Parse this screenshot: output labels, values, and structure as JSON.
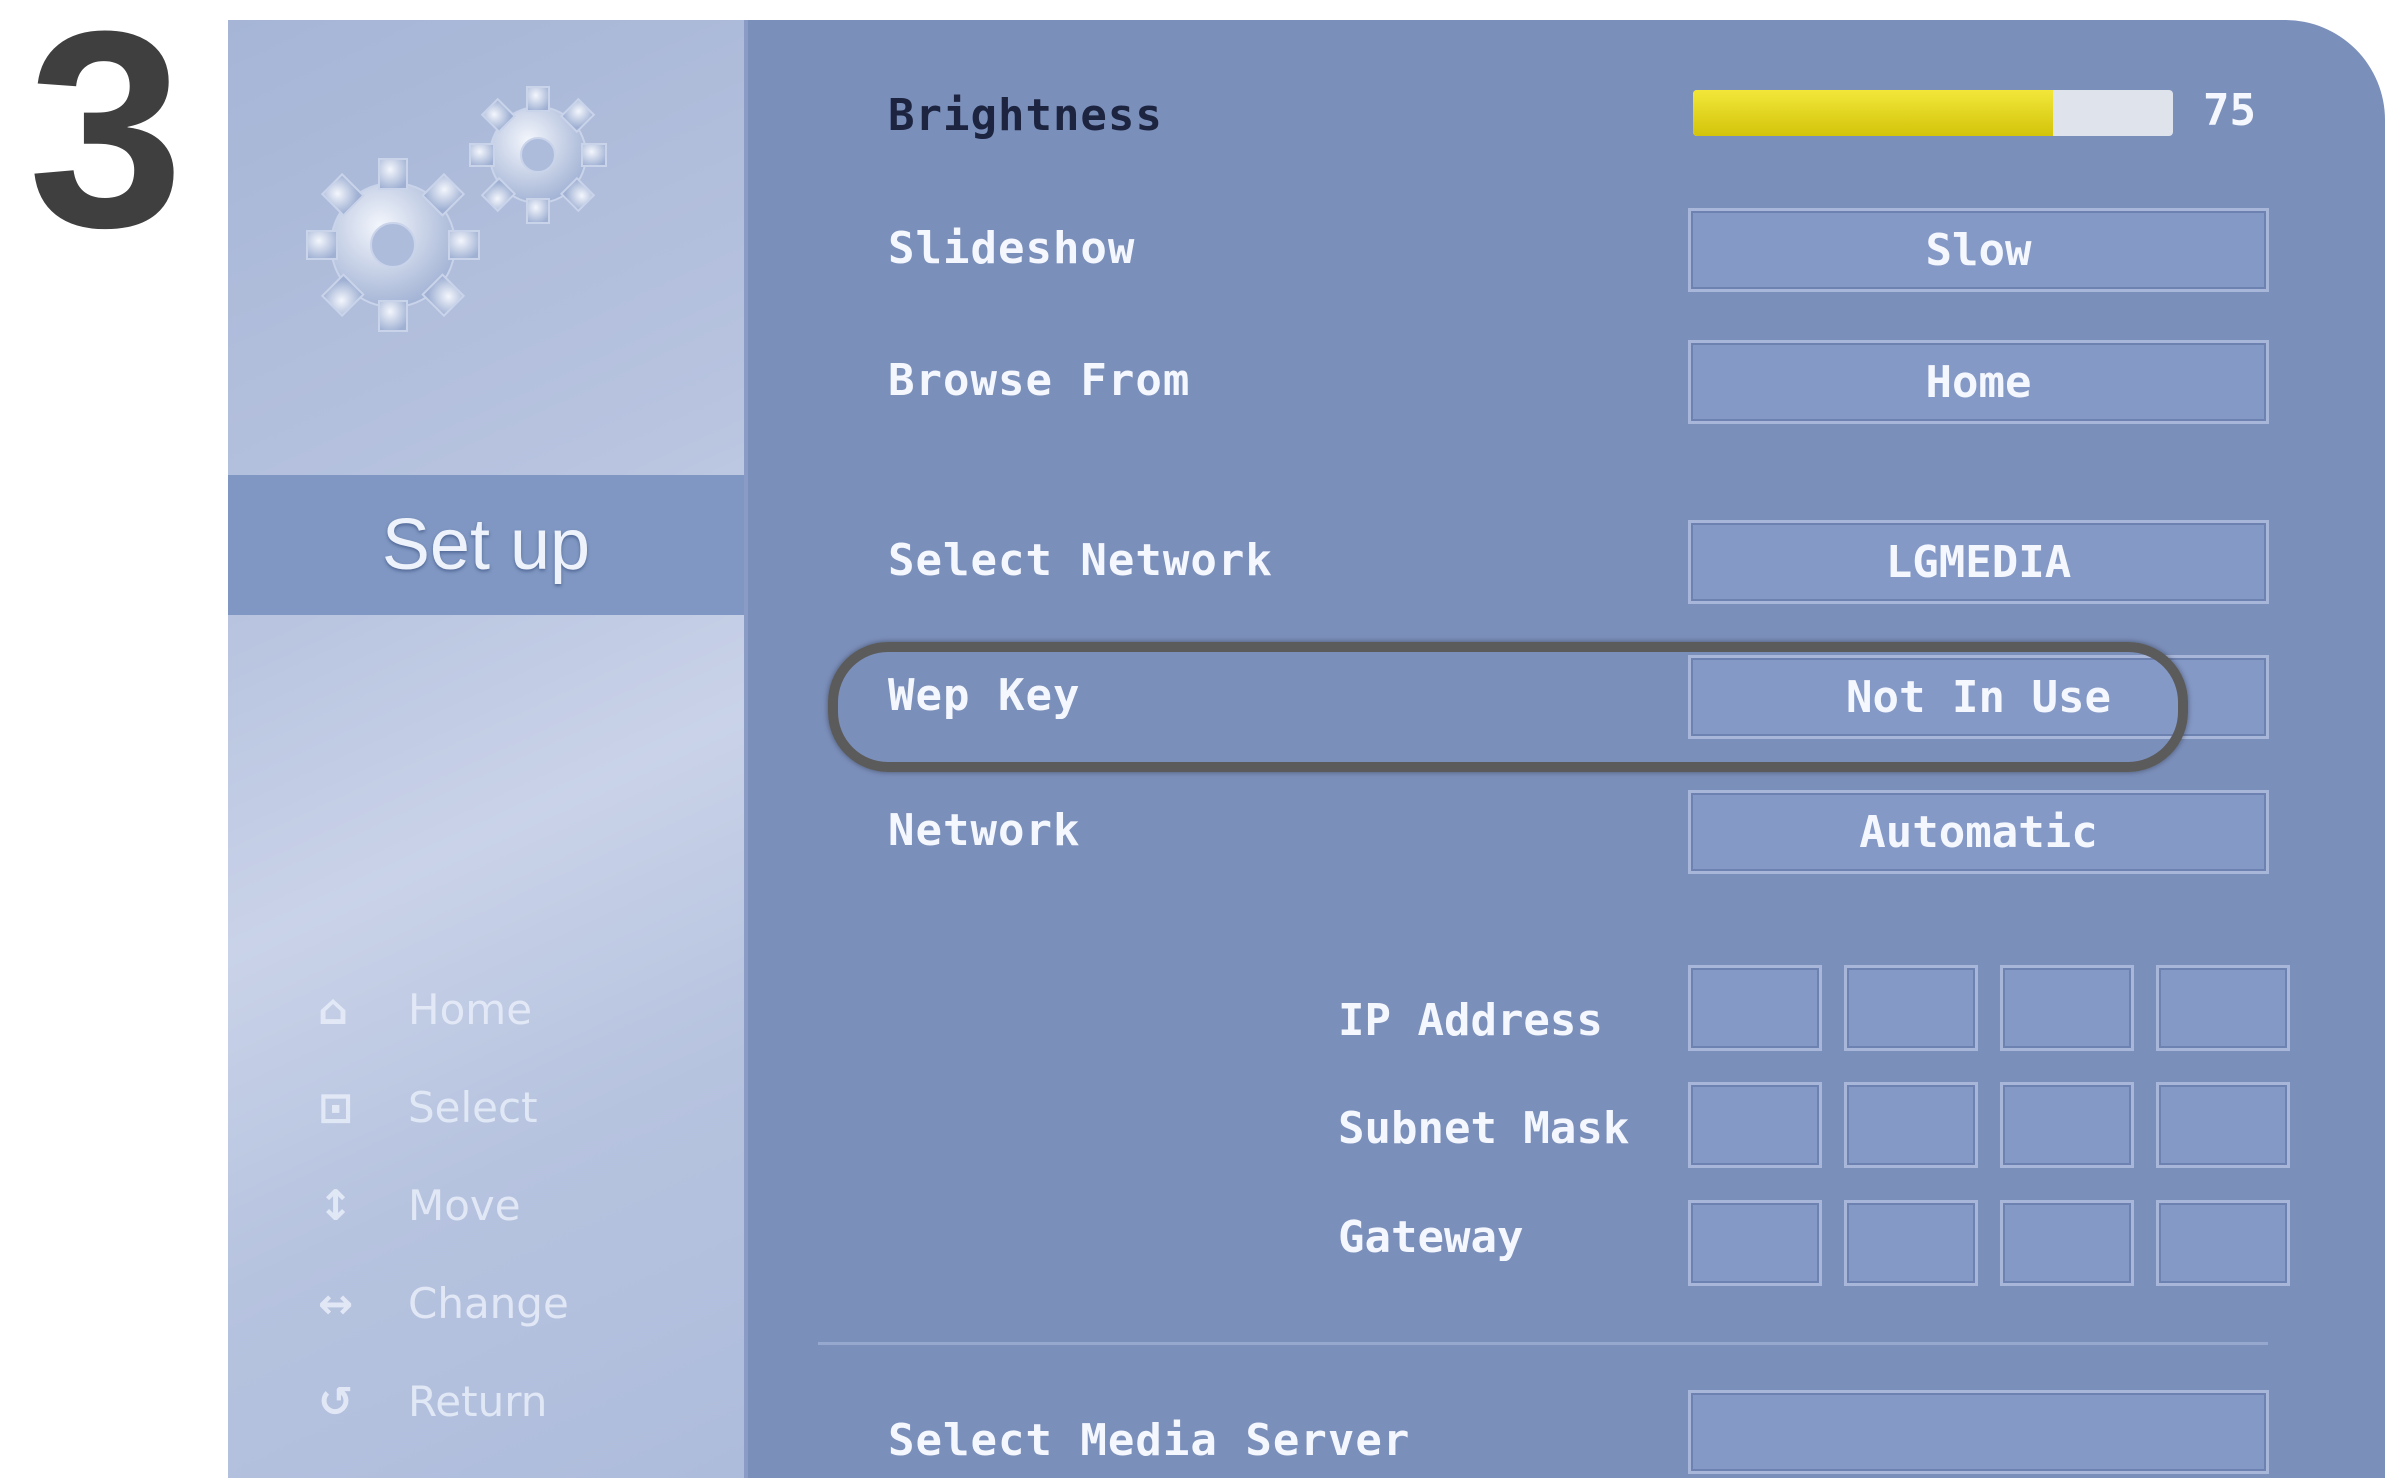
{
  "step": "3",
  "sidebar": {
    "title": "Set up",
    "help": [
      {
        "key": "⌂",
        "label": "Home"
      },
      {
        "key": "⊡",
        "label": "Select"
      },
      {
        "key": "↕",
        "label": "Move"
      },
      {
        "key": "↔",
        "label": "Change"
      },
      {
        "key": "↺",
        "label": "Return"
      }
    ]
  },
  "settings": {
    "brightness": {
      "label": "Brightness",
      "value": "75",
      "level": 0.75
    },
    "slideshow": {
      "label": "Slideshow",
      "value": "Slow"
    },
    "browse_from": {
      "label": "Browse From",
      "value": "Home"
    },
    "select_network": {
      "label": "Select Network",
      "value": "LGMEDIA"
    },
    "wep_key": {
      "label": "Wep Key",
      "value": "Not In Use"
    },
    "network": {
      "label": "Network",
      "value": "Automatic"
    },
    "ip_address": {
      "label": "IP Address"
    },
    "subnet_mask": {
      "label": "Subnet Mask"
    },
    "gateway": {
      "label": "Gateway"
    },
    "select_media_server": {
      "label": "Select Media Server",
      "value": ""
    }
  },
  "colors": {
    "panel": "#7b8fbb",
    "brightness_fill": "#e8da20",
    "highlight_ring": "#5b5b5b"
  },
  "icons": {
    "sidebar_graphic": "gears-icon"
  }
}
